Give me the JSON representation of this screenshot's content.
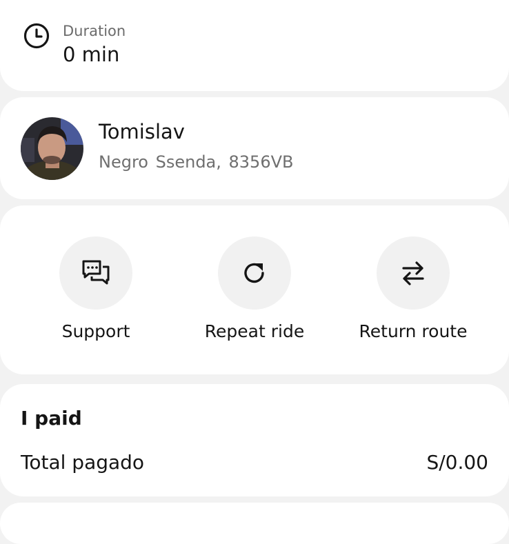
{
  "trip": {
    "duration_label": "Duration",
    "duration_value": "0 min"
  },
  "driver": {
    "name": "Tomislav",
    "vehicle": "Negro  Ssenda, 8356VB"
  },
  "actions": [
    {
      "label": "Support",
      "icon": "chat-bubbles-icon"
    },
    {
      "label": "Repeat ride",
      "icon": "refresh-icon"
    },
    {
      "label": "Return route",
      "icon": "swap-arrows-icon"
    }
  ],
  "payment": {
    "title": "I paid",
    "total_label": "Total pagado",
    "total_amount": "S/0.00"
  },
  "colors": {
    "background": "#f2f2f2",
    "card": "#ffffff",
    "icon_circle": "#f1f1f1",
    "text_primary": "#151515",
    "text_secondary": "#6f6f6f"
  }
}
